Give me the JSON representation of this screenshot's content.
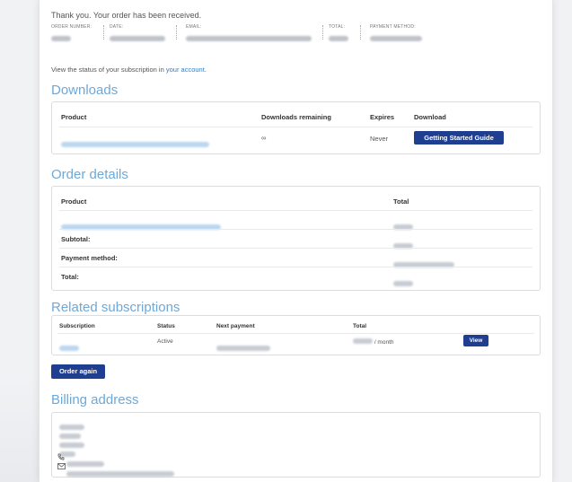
{
  "header": {
    "thanks": "Thank you. Your order has been received."
  },
  "overview": {
    "order_label": "ORDER NUMBER:",
    "date_label": "DATE:",
    "email_label": "EMAIL:",
    "total_label": "TOTAL:",
    "payment_label": "PAYMENT METHOD:"
  },
  "status": {
    "text": "View the status of your subscription in ",
    "link": "your account",
    "end": "."
  },
  "downloads": {
    "title": "Downloads",
    "headers": {
      "product": "Product",
      "remaining": "Downloads remaining",
      "expires": "Expires",
      "download": "Download"
    },
    "row": {
      "remaining": "∞",
      "expires": "Never",
      "button": "Getting Started Guide"
    }
  },
  "order_details": {
    "title": "Order details",
    "headers": {
      "product": "Product",
      "total": "Total"
    },
    "subtotal_label": "Subtotal:",
    "payment_label": "Payment method:",
    "total_label": "Total:"
  },
  "related": {
    "title": "Related subscriptions",
    "headers": {
      "subscription": "Subscription",
      "status": "Status",
      "next": "Next payment",
      "total": "Total"
    },
    "row": {
      "status": "Active",
      "per": "/ month",
      "button": "View"
    }
  },
  "order_again": "Order again",
  "billing": {
    "title": "Billing address"
  },
  "colors": {
    "accent": "#6fa8d6",
    "button": "#1f3e8f",
    "link": "#3a7bbf"
  },
  "icons": {
    "phone": "phone-icon",
    "email": "envelope-icon"
  }
}
